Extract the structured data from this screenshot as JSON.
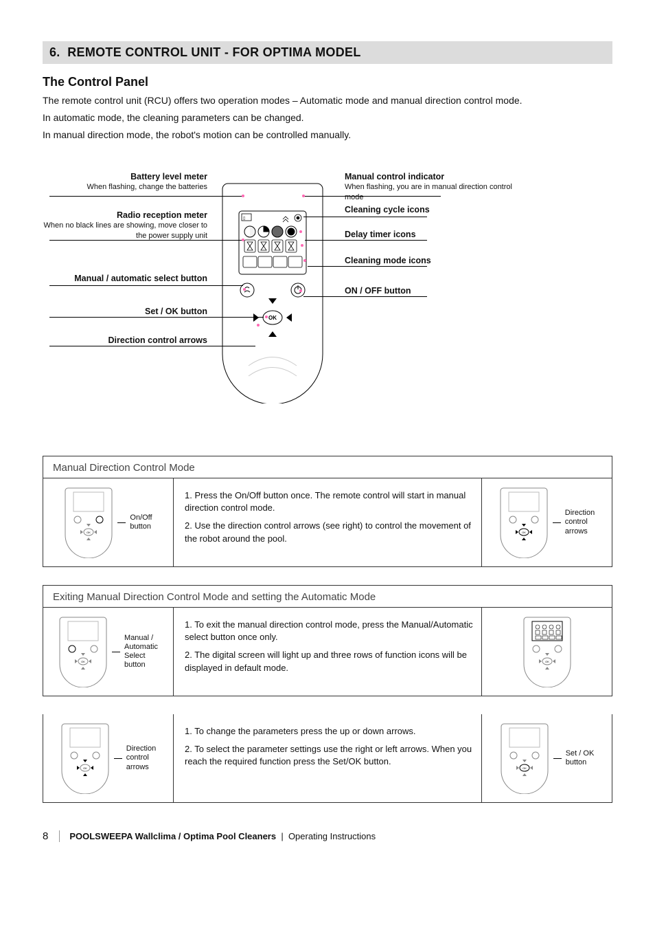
{
  "section": {
    "number": "6.",
    "title": "REMOTE CONTROL UNIT - FOR OPTIMA MODEL"
  },
  "subtitle": "The Control Panel",
  "intro": [
    "The remote control unit (RCU) offers two operation modes – Automatic mode and manual direction control mode.",
    "In automatic mode, the cleaning parameters can be changed.",
    "In manual direction mode, the robot's motion can be controlled manually."
  ],
  "callouts_left": [
    {
      "title": "Battery level meter",
      "desc": "When flashing, change the batteries"
    },
    {
      "title": "Radio reception meter",
      "desc": "When no black lines are showing, move closer to the power supply unit"
    },
    {
      "title": "Manual / automatic select button",
      "desc": ""
    },
    {
      "title": "Set / OK button",
      "desc": ""
    },
    {
      "title": "Direction control arrows",
      "desc": ""
    }
  ],
  "callouts_right": [
    {
      "title": "Manual control indicator",
      "desc": "When flashing, you are in manual direction control mode"
    },
    {
      "title": "Cleaning cycle icons",
      "desc": ""
    },
    {
      "title": "Delay timer icons",
      "desc": ""
    },
    {
      "title": "Cleaning mode icons",
      "desc": ""
    },
    {
      "title": "ON / OFF button",
      "desc": ""
    }
  ],
  "remote": {
    "ok_label": "OK"
  },
  "box1": {
    "title": "Manual Direction Control Mode",
    "left_label": "On/Off\nbutton",
    "steps": [
      "1.  Press the On/Off button once. The remote control will start in manual direction control mode.",
      "2.  Use the direction control arrows (see right) to control the movement of the robot around the pool."
    ],
    "right_label": "Direction\ncontrol\narrows"
  },
  "box2": {
    "title": "Exiting Manual Direction Control Mode and setting the Automatic Mode",
    "left_label": "Manual /\nAutomatic\nSelect\nbutton",
    "steps": [
      "1.  To exit the manual direction control mode, press the Manual/Automatic select button once only.",
      "2.  The digital screen will light up and three rows of function icons will be displayed in default mode."
    ]
  },
  "box3": {
    "left_label": "Direction\ncontrol\narrows",
    "steps": [
      "1.  To change the parameters press the up or down arrows.",
      "2.  To select the parameter settings use the right or left arrows. When you reach the required function press the Set/OK button."
    ],
    "right_label": "Set / OK\nbutton"
  },
  "footer": {
    "page": "8",
    "bold": "POOLSWEEPA  Wallclima / Optima Pool Cleaners",
    "sep": "|",
    "tail": "Operating Instructions"
  }
}
